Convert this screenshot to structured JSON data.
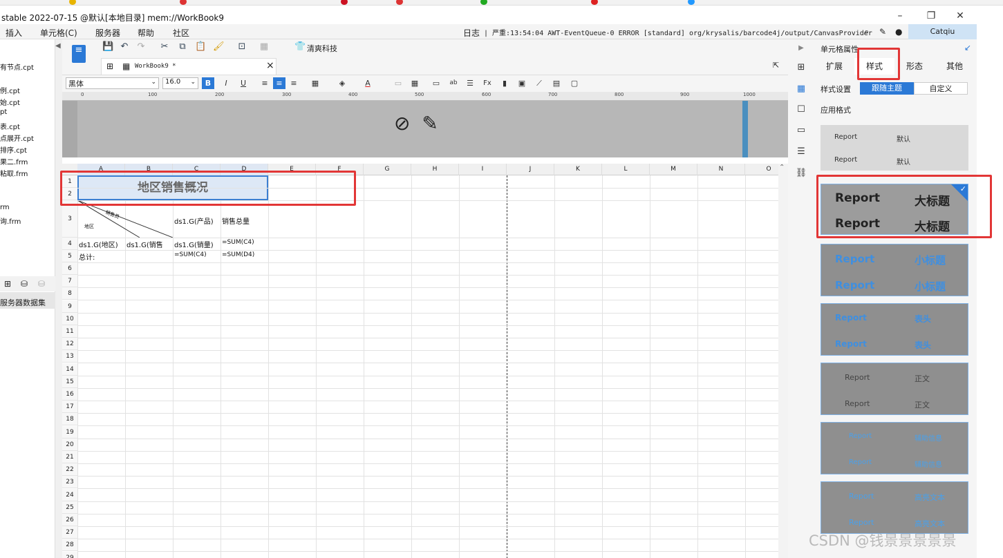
{
  "window": {
    "title": "stable 2022-07-15 @默认[本地目录]    mem://WorkBook9",
    "min": "–",
    "max": "❐",
    "close": "✕"
  },
  "menu": {
    "items": [
      "插入",
      "单元格(C)",
      "服务器",
      "帮助",
      "社区"
    ],
    "log_label": "日志",
    "log_text": "| 严重:13:54:04 AWT-EventQueue-0 ERROR [standard] org/krysalis/barcode4j/output/CanvasProvider",
    "user": "Catqiu"
  },
  "left_panel": {
    "files": [
      "有节点.cpt",
      "例.cpt",
      "始.cpt",
      "pt",
      "表.cpt",
      "点展开.cpt",
      "排序.cpt",
      "果二.frm",
      "粘取.frm",
      "rm",
      "询.frm"
    ],
    "dataset_label": "服务器数据集"
  },
  "toolbar": {
    "brand": "清爽科技",
    "tab_label": "WorkBook9 *",
    "tab_close": "×"
  },
  "format": {
    "font_name": "黑体",
    "font_size": "16.0"
  },
  "ruler": {
    "ticks": [
      "0",
      "100",
      "200",
      "300",
      "400",
      "500",
      "600",
      "700",
      "800",
      "900",
      "1000"
    ]
  },
  "grid": {
    "columns": [
      "A",
      "B",
      "C",
      "D",
      "E",
      "F",
      "G",
      "H",
      "I",
      "J",
      "K",
      "L",
      "M",
      "N",
      "O"
    ],
    "rows": [
      "1",
      "2",
      "3",
      "4",
      "5",
      "6",
      "7",
      "8",
      "9",
      "10",
      "11",
      "12",
      "13",
      "14",
      "15",
      "16",
      "17",
      "18",
      "19",
      "20",
      "21",
      "22",
      "23",
      "24",
      "25",
      "26",
      "27",
      "28",
      "29"
    ],
    "title_cell": "地区销售概况",
    "diag_top": "销售员",
    "diag_bottom": "地区",
    "c3": "ds1.G(产品)",
    "d3": "销售总量",
    "a4": "ds1.G(地区)",
    "b4": "ds1.G(销售",
    "c4": "ds1.G(销量)",
    "d4": "=SUM(C4)",
    "a5": "总计:",
    "c5": "=SUM(C4)",
    "d5": "=SUM(D4)"
  },
  "right_panel": {
    "title": "单元格属性",
    "tabs": [
      "扩展",
      "样式",
      "形态",
      "其他"
    ],
    "settings_label": "样式设置",
    "follow_theme": "跟随主题",
    "custom": "自定义",
    "apply_label": "应用格式",
    "swatches": [
      {
        "a": "Report",
        "b": "默认",
        "color_a": "#333333",
        "color_b": "#333333"
      },
      {
        "a": "Report",
        "b": "大标题",
        "color_a": "#222222",
        "color_b": "#222222"
      },
      {
        "a": "Report",
        "b": "小标题",
        "color_a": "#3f8fe0",
        "color_b": "#3f8fe0"
      },
      {
        "a": "Report",
        "b": "表头",
        "color_a": "#3f8fe0",
        "color_b": "#3f8fe0"
      },
      {
        "a": "Report",
        "b": "正文",
        "color_a": "#444444",
        "color_b": "#444444"
      },
      {
        "a": "Report",
        "b": "辅助信息",
        "color_a": "#4aa0ea",
        "color_b": "#4aa0ea"
      },
      {
        "a": "Report",
        "b": "高亮文本",
        "color_a": "#4aa0ea",
        "color_b": "#4aa0ea"
      }
    ]
  },
  "watermark": "CSDN @钱景景景景景"
}
